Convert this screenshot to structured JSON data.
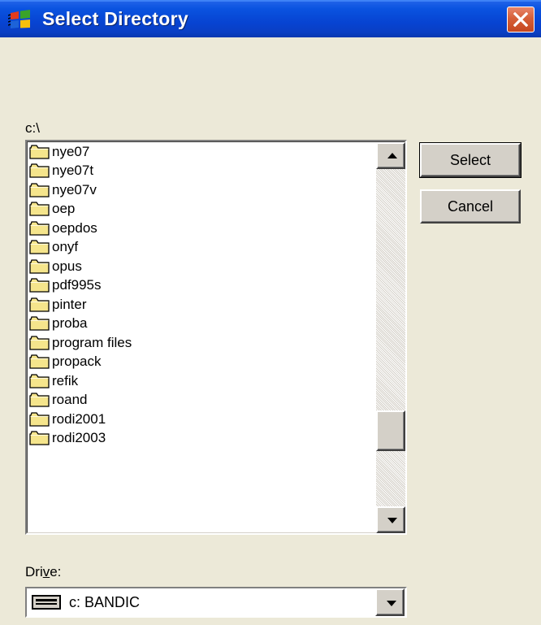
{
  "window": {
    "title": "Select Directory",
    "icon": "windows-flag-icon",
    "close_icon": "close-icon"
  },
  "path": "c:\\",
  "directories": [
    "nye07",
    "nye07t",
    "nye07v",
    "oep",
    "oepdos",
    "onyf",
    "opus",
    "pdf995s",
    "pinter",
    "proba",
    "program files",
    "propack",
    "refik",
    "roand",
    "rodi2001",
    "rodi2003"
  ],
  "scrollbar": {
    "up_icon": "scroll-up-arrow-icon",
    "down_icon": "scroll-down-arrow-icon"
  },
  "buttons": {
    "select": "Select",
    "cancel": "Cancel"
  },
  "drive": {
    "label_pre": "Dri",
    "label_accel": "v",
    "label_post": "e:",
    "value": "c: BANDIC",
    "icon": "drive-icon"
  },
  "colors": {
    "titlebar": "#0a53e0",
    "close_button": "#d65f38",
    "dialog_bg": "#ece9d8",
    "folder": "#f5e58c"
  }
}
